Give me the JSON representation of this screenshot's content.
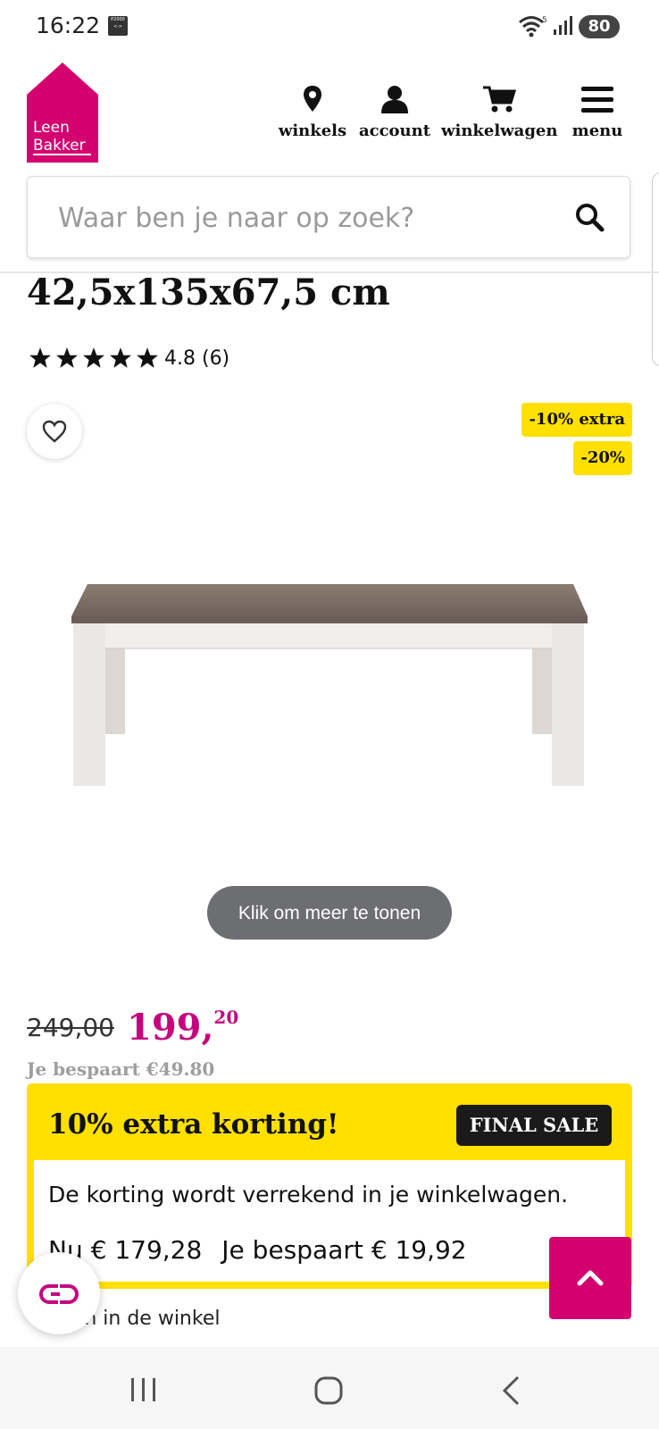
{
  "status_bar": {
    "time": "16:22",
    "p2000_label": "P2000",
    "battery": "80"
  },
  "header": {
    "logo_line1": "Leen",
    "logo_line2": "Bakker",
    "brand_color": "#d4006f",
    "nav": [
      {
        "label": "winkels",
        "icon": "location-pin-icon"
      },
      {
        "label": "account",
        "icon": "user-icon"
      },
      {
        "label": "winkelwagen",
        "icon": "cart-icon"
      },
      {
        "label": "menu",
        "icon": "hamburger-menu-icon"
      }
    ]
  },
  "search": {
    "placeholder": "Waar ben je naar op zoek?"
  },
  "product": {
    "title": "42,5x135x67,5 cm",
    "rating_value": 4.8,
    "rating_text": "4.8 (6)",
    "promo_badges": [
      "-10% extra",
      "-20%"
    ],
    "promo_color": "#ffe000",
    "more_button": "Klik om meer te tonen"
  },
  "price": {
    "old": "249,00",
    "new_whole": "199,",
    "new_decimal": "20",
    "savings": "Je bespaart €49.80",
    "accent": "#c4067e"
  },
  "discount": {
    "title": "10% extra korting!",
    "badge": "FINAL SALE",
    "note": "De korting wordt verrekend in je winkelwagen.",
    "now_label": "Nu",
    "now_price": "€ 179,28",
    "now_savings": "Je bespaart € 19,92"
  },
  "instore": "Alleen in de winkel"
}
